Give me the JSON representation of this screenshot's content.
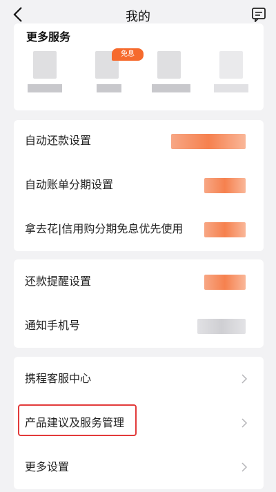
{
  "header": {
    "title": "我的",
    "back_icon": "chevron-left-icon",
    "message_icon": "message-icon"
  },
  "services": {
    "title": "更多服务",
    "badge": "免息",
    "items": [
      "",
      "",
      "",
      ""
    ]
  },
  "repay": {
    "auto_repay": "自动还款设置",
    "auto_installment": "自动账单分期设置",
    "credit_priority": "拿去花|信用购分期免息优先使用"
  },
  "notify": {
    "reminder": "还款提醒设置",
    "phone": "通知手机号"
  },
  "support": {
    "customer_service": "携程客服中心",
    "feedback": "产品建议及服务管理",
    "more_settings": "更多设置"
  },
  "colors": {
    "accent": "#f66a2d",
    "highlight": "#e23a3a",
    "background": "#f2f2f4"
  }
}
